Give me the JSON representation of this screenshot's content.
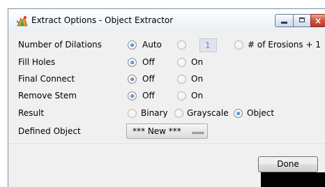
{
  "window": {
    "title": "Extract Options - Object Extractor",
    "close_glyph": "×"
  },
  "rows": {
    "dilations": {
      "label": "Number of Dilations",
      "auto_label": "Auto",
      "auto_selected": true,
      "field_value": "1",
      "erosions_label": "# of Erosions + 1"
    },
    "fill_holes": {
      "label": "Fill Holes",
      "off_label": "Off",
      "on_label": "On",
      "selected": "Off"
    },
    "final_connect": {
      "label": "Final Connect",
      "off_label": "Off",
      "on_label": "On",
      "selected": "Off"
    },
    "remove_stem": {
      "label": "Remove Stem",
      "off_label": "Off",
      "on_label": "On",
      "selected": "Off"
    },
    "result": {
      "label": "Result",
      "binary_label": "Binary",
      "grayscale_label": "Grayscale",
      "object_label": "Object",
      "selected": "Object"
    },
    "defined_object": {
      "label": "Defined Object",
      "value": "*** New ***"
    }
  },
  "buttons": {
    "done_label": "Done"
  },
  "icons": {
    "app": "object-extractor-app-icon",
    "minimize": "minimize-icon",
    "maximize": "maximize-icon",
    "close": "close-icon",
    "dropdown": "dropdown-indicator-icon"
  }
}
